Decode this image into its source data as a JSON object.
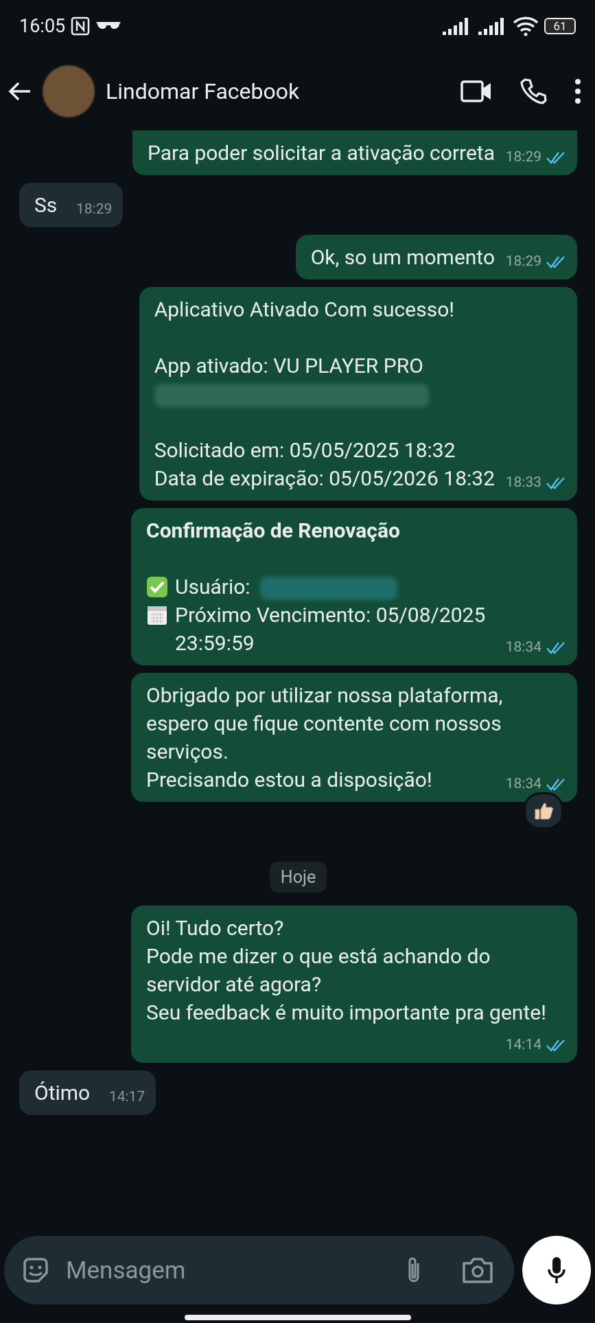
{
  "status_bar": {
    "time": "16:05",
    "battery": "61"
  },
  "header": {
    "contact_name": "Lindomar Facebook"
  },
  "messages": [
    {
      "kind": "outgoing",
      "paragraphs": [
        [
          {
            "text": "Para poder solicitar a ativação correta"
          }
        ]
      ],
      "time": "18:29",
      "read": true
    },
    {
      "kind": "incoming",
      "paragraphs": [
        [
          {
            "text": "Ss"
          }
        ]
      ],
      "time": "18:29"
    },
    {
      "kind": "outgoing",
      "paragraphs": [
        [
          {
            "text": "Ok, so um momento"
          }
        ]
      ],
      "time": "18:29",
      "read": true
    },
    {
      "kind": "outgoing",
      "paragraphs": [
        [
          {
            "text": "Aplicativo Ativado Com sucesso!"
          }
        ],
        [
          {
            "text": "App ativado:  VU PLAYER PRO"
          },
          {
            "redacted": true
          }
        ],
        [
          {
            "text": "Solicitado em: 05/05/2025 18:32"
          },
          {
            "text": "Data de expiração: 05/05/2026 18:32"
          }
        ]
      ],
      "time": "18:33",
      "read": true
    },
    {
      "kind": "outgoing",
      "paragraphs": [
        [
          {
            "text": "Confirmação de Renovação",
            "bold": true
          }
        ],
        [
          {
            "kind": "check-item",
            "text": "Usuário:",
            "redacted": true
          },
          {
            "kind": "calendar-item",
            "text": "Próximo Vencimento: 05/08/2025 23:59:59"
          }
        ]
      ],
      "time": "18:34",
      "read": true
    },
    {
      "kind": "outgoing",
      "paragraphs": [
        [
          {
            "text": "Obrigado por utilizar nossa plataforma, espero que fique contente com nossos serviços."
          },
          {
            "text": "Precisando estou a disposição!"
          }
        ]
      ],
      "time": "18:34",
      "read": true,
      "reacted": true
    },
    {
      "kind": "date",
      "label": "Hoje"
    },
    {
      "kind": "outgoing",
      "paragraphs": [
        [
          {
            "text": "Oi! Tudo certo?"
          },
          {
            "text": "Pode me dizer o que está achando do servidor até agora?"
          },
          {
            "text": "Seu feedback é muito importante pra gente!"
          }
        ]
      ],
      "time": "14:14",
      "read": true
    },
    {
      "kind": "incoming",
      "paragraphs": [
        [
          {
            "text": "Ótimo"
          }
        ]
      ],
      "time": "14:17"
    }
  ],
  "composer": {
    "placeholder": "Mensagem"
  }
}
